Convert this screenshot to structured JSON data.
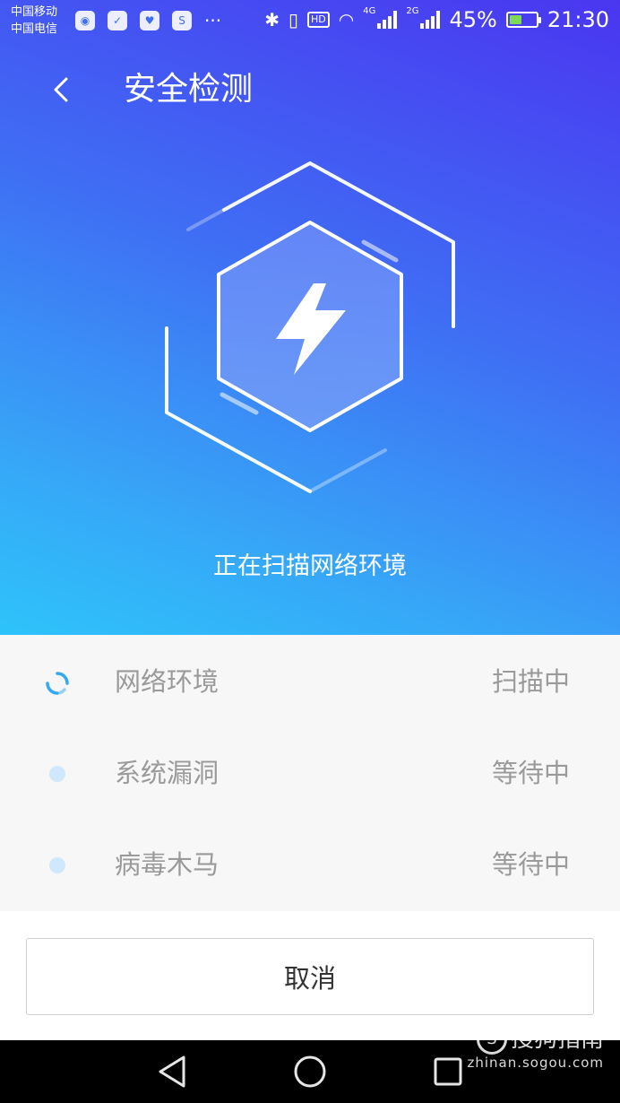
{
  "status_bar": {
    "carrier_1": "中国移动",
    "carrier_2": "中国电信",
    "left_icons": [
      "wifi-hotspot-icon",
      "shield-icon",
      "heartbeat-icon",
      "app-icon"
    ],
    "more": "···",
    "net_4g": "4G",
    "net_2g": "2G",
    "hd": "HD",
    "battery_percent": "45%",
    "battery_level": 0.45,
    "time": "21:30"
  },
  "header": {
    "title": "安全检测",
    "back_icon": "chevron-left-icon"
  },
  "hero": {
    "emblem_icon": "lightning-bolt-icon",
    "scan_text": "正在扫描网络环境"
  },
  "scan_items": [
    {
      "label": "网络环境",
      "status": "扫描中",
      "indicator": "spinner-icon"
    },
    {
      "label": "系统漏洞",
      "status": "等待中",
      "indicator": "dot-icon"
    },
    {
      "label": "病毒木马",
      "status": "等待中",
      "indicator": "dot-icon"
    }
  ],
  "cancel_label": "取消",
  "system_nav": [
    "back-icon",
    "home-icon",
    "recents-icon"
  ],
  "watermark": {
    "logo_letter": "S",
    "logo_text": "搜狗指南",
    "url": "zhinan.sogou.com"
  },
  "colors": {
    "gradient_top": "#4a36f0",
    "gradient_bottom": "#2ec3fb",
    "list_bg": "#f7f7f7",
    "text_gray": "#9a9a9a",
    "spinner": "#35a9f0"
  }
}
